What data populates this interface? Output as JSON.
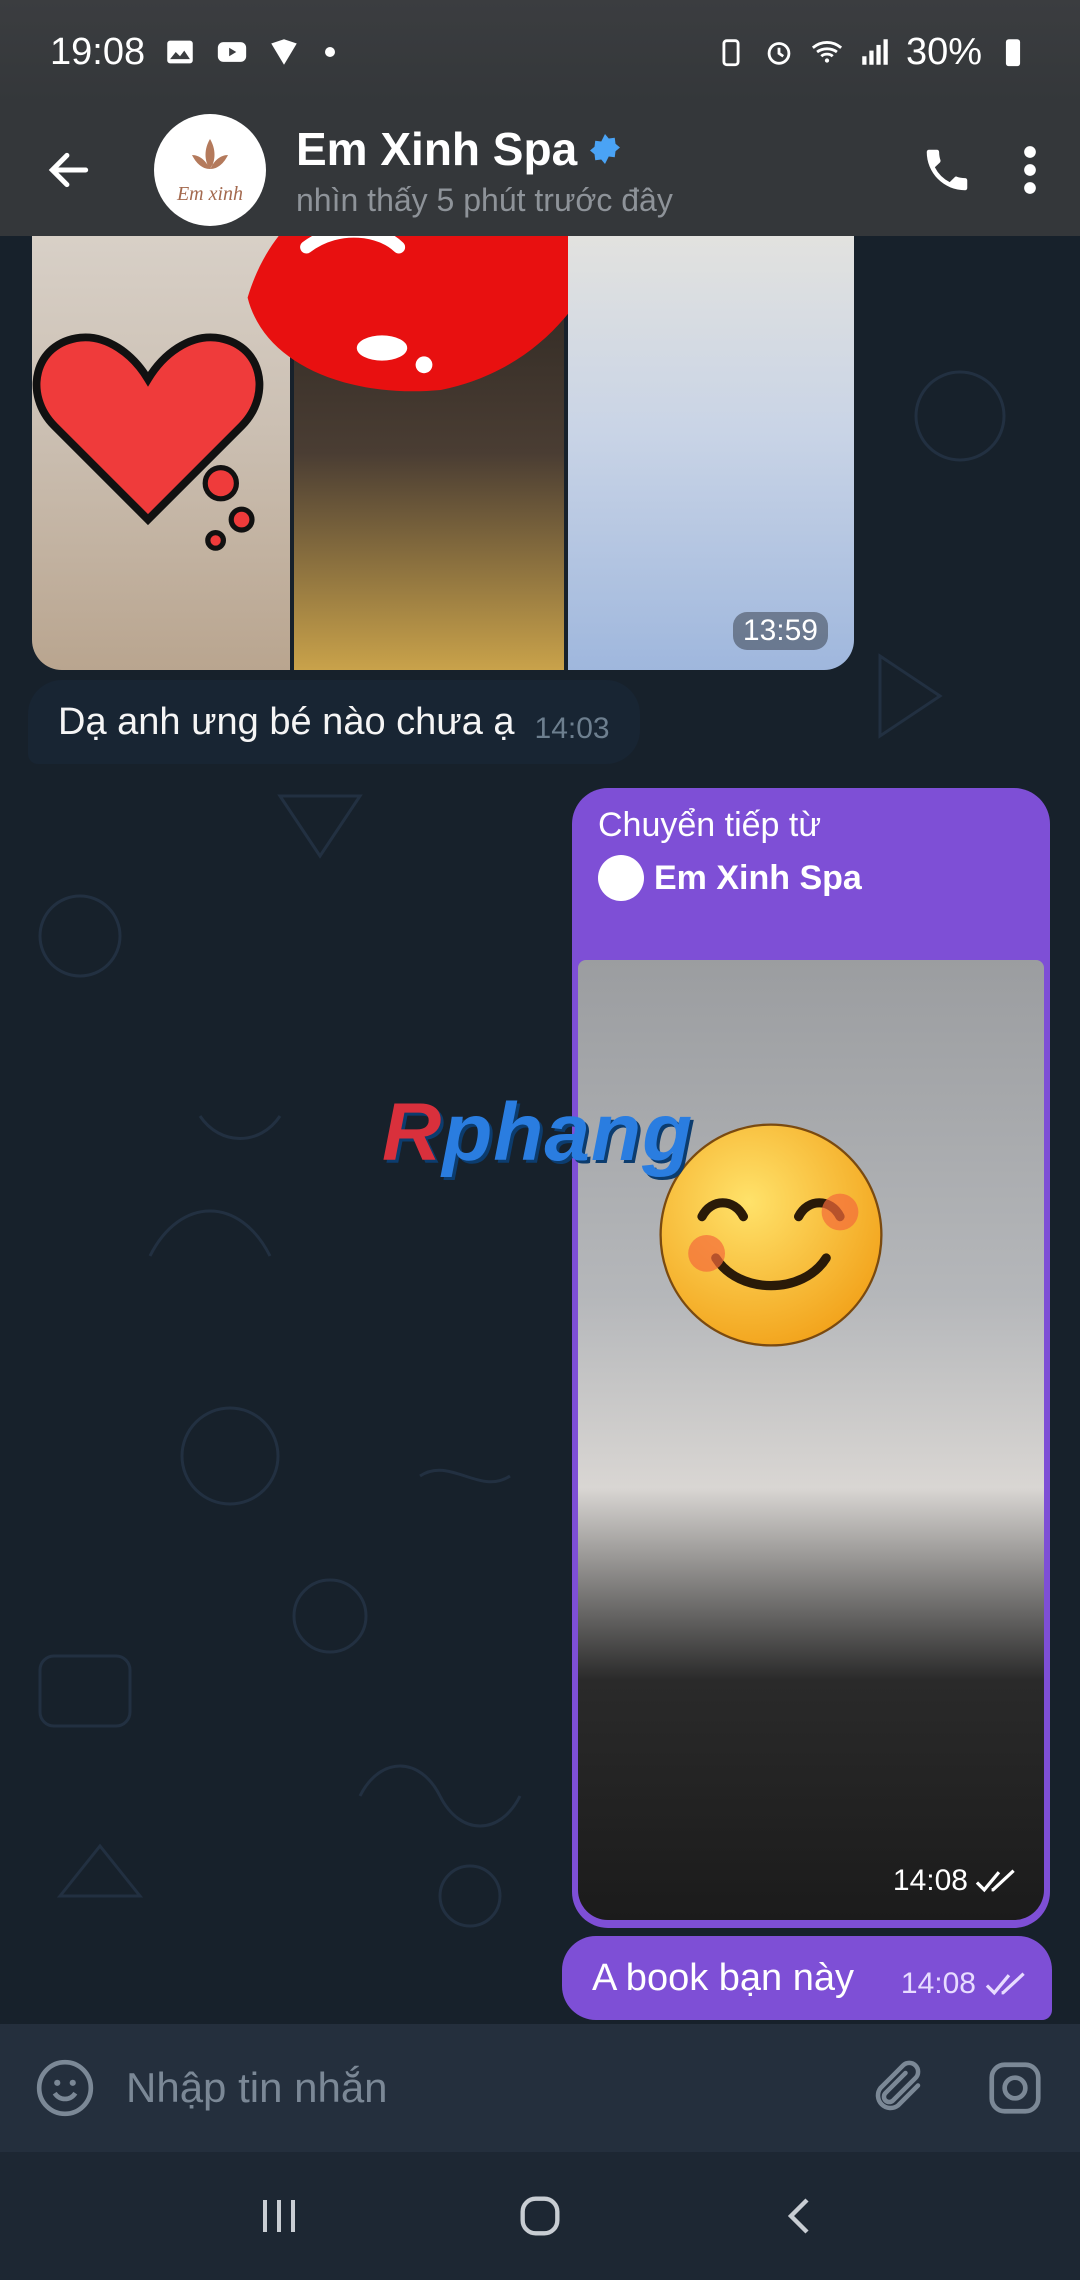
{
  "status_bar": {
    "time": "19:08",
    "battery": "30%"
  },
  "header": {
    "title": "Em Xinh Spa",
    "subtitle": "nhìn thấy 5 phút trước đây",
    "avatar_text": "Em xinh"
  },
  "messages": {
    "album_time": "13:59",
    "incoming_text": "Dạ anh ưng bé nào chưa ạ",
    "incoming_time": "14:03",
    "forward_label": "Chuyển tiếp từ",
    "forward_source": "Em Xinh Spa",
    "forward_photo_time": "14:08",
    "outgoing_text": "A book bạn này",
    "outgoing_time": "14:08"
  },
  "watermark": {
    "first": "R",
    "rest": "phang"
  },
  "input": {
    "placeholder": "Nhập tin nhắn"
  },
  "colors": {
    "accent": "#7e4fd6",
    "background": "#17212b",
    "header": "#34373a"
  }
}
